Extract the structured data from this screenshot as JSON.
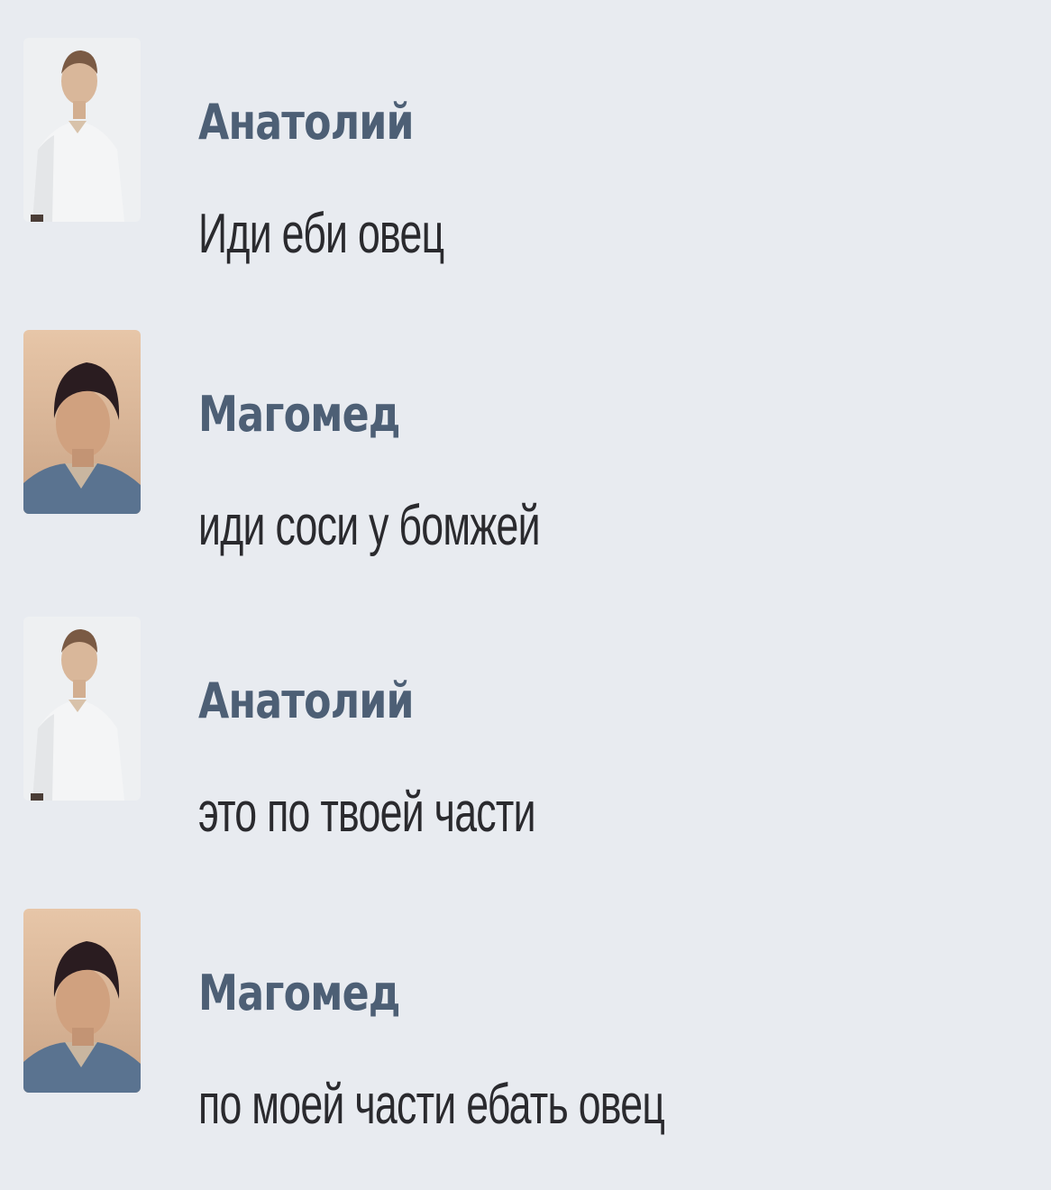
{
  "messages": [
    {
      "author": "Анатолий",
      "text": "Иди еби овец",
      "avatar_icon": "man-white-shirt-avatar"
    },
    {
      "author": "Магомед",
      "text": "иди соси у бомжей",
      "avatar_icon": "young-man-dark-hair-avatar"
    },
    {
      "author": "Анатолий",
      "text": "это по твоей части",
      "avatar_icon": "man-white-shirt-avatar"
    },
    {
      "author": "Магомед",
      "text": "по моей части ебать овец",
      "avatar_icon": "young-man-dark-hair-avatar"
    }
  ],
  "colors": {
    "background": "#e8ebf0",
    "author_name": "#4d5f75",
    "message_text": "#2a2a2e"
  }
}
